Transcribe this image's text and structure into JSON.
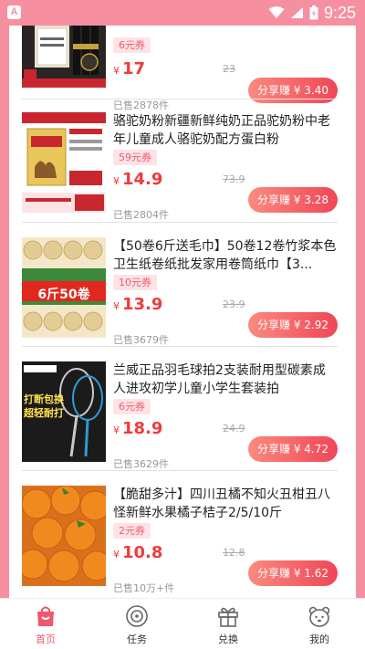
{
  "status_bar": {
    "time": "9:25",
    "app_letter": "A"
  },
  "products": [
    {
      "title": "",
      "coupon": "6元券",
      "price": "17",
      "original_price": "23",
      "sold": "已售2878件",
      "share": "分享赚 ¥ 3.40",
      "image": "product-image-top"
    },
    {
      "title": "骆驼奶粉新疆新鲜纯奶正品驼奶粉中老年儿童成人骆驼奶配方蛋白粉",
      "coupon": "59元券",
      "price": "14.9",
      "original_price": "73.9",
      "sold": "已售2804件",
      "share": "分享赚 ¥ 3.28",
      "image": "camel-milk-powder"
    },
    {
      "title": "【50卷6斤送毛巾】50卷12卷竹浆本色卫生纸卷纸批发家用卷筒纸巾【3...",
      "coupon": "10元券",
      "price": "13.9",
      "original_price": "23.9",
      "sold": "已售3679件",
      "share": "分享赚 ¥ 2.92",
      "image": "toilet-paper-rolls",
      "image_text": "6斤50卷"
    },
    {
      "title": "兰威正品羽毛球拍2支装耐用型碳素成人进攻初学儿童小学生套装拍",
      "coupon": "6元券",
      "price": "18.9",
      "original_price": "24.9",
      "sold": "已售3629件",
      "share": "分享赚 ¥ 4.72",
      "image": "badminton-racket",
      "image_text": "打断包换 超轻耐打"
    },
    {
      "title": "【脆甜多汁】四川丑橘不知火丑柑丑八怪新鲜水果橘子桔子2/5/10斤",
      "coupon": "2元券",
      "price": "10.8",
      "original_price": "12.8",
      "sold": "已售10万+件",
      "share": "分享赚 ¥ 1.62",
      "image": "ugly-oranges"
    }
  ],
  "tabs": [
    {
      "label": "首页",
      "icon": "shopping-bag-icon",
      "active": true
    },
    {
      "label": "任务",
      "icon": "task-icon",
      "active": false
    },
    {
      "label": "兑换",
      "icon": "gift-icon",
      "active": false
    },
    {
      "label": "我的",
      "icon": "bear-icon",
      "active": false
    }
  ],
  "colors": {
    "accent": "#f04657",
    "page_bg": "#f68fa0",
    "price": "#ef3b3b",
    "coupon_bg": "#fde3e6"
  },
  "currency": "¥"
}
